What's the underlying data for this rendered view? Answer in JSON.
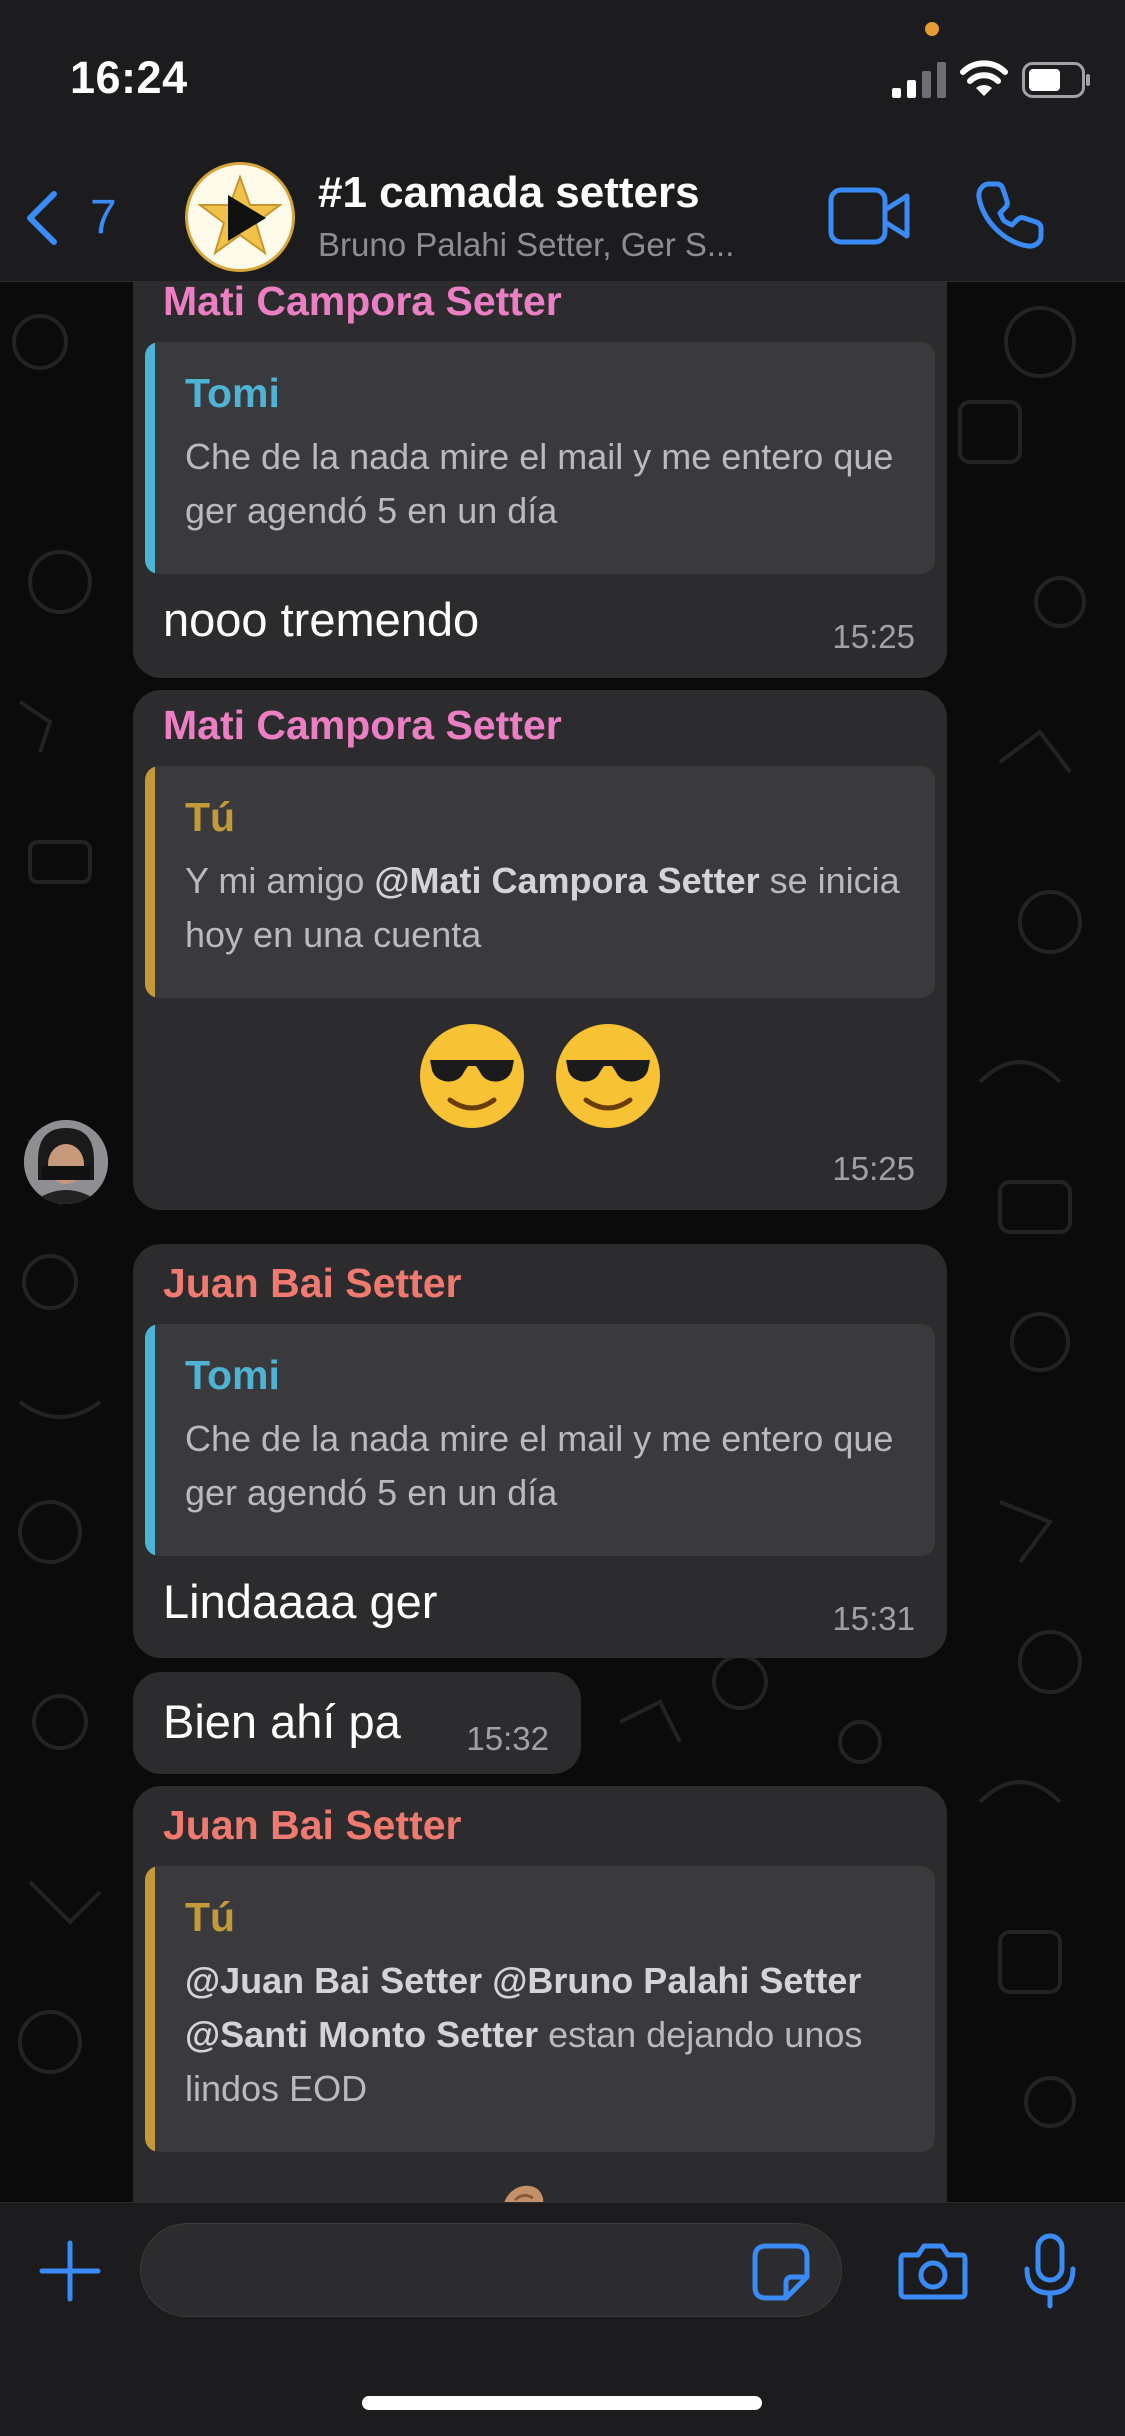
{
  "status_bar": {
    "time": "16:24"
  },
  "header": {
    "back_count": "7",
    "title": "#1 camada setters",
    "subtitle": "Bruno Palahi Setter, Ger S..."
  },
  "messages": [
    {
      "sender": "Mati Campora Setter",
      "quote_author": "Tomi",
      "quote_text": "Che de la nada mire el mail y me entero que ger agendó 5 en un día",
      "text": "nooo tremendo",
      "time": "15:25"
    },
    {
      "sender": "Mati Campora Setter",
      "quote_author": "Tú",
      "quote_text_before": "Y mi amigo ",
      "quote_mention": "@Mati Campora Setter",
      "quote_text_after": " se inicia hoy en una cuenta",
      "emoji": "😎 😎",
      "time": "15:25"
    },
    {
      "sender": "Juan Bai Setter",
      "quote_author": "Tomi",
      "quote_text": "Che de la nada mire el mail y me entero que ger agendó 5 en un día",
      "text": "Lindaaaa ger",
      "time": "15:31"
    },
    {
      "text": "Bien ahí pa",
      "time": "15:32"
    },
    {
      "sender": "Juan Bai Setter",
      "quote_author": "Tú",
      "quote_mention_1": "@Juan Bai Setter",
      "quote_mention_2": "@Bruno Palahi Setter",
      "quote_mention_3": "@Santi Monto Setter",
      "quote_text_after": " estan dejando unos lindos EOD"
    }
  ],
  "input": {
    "placeholder": ""
  },
  "colors": {
    "accent": "#3a8bf5",
    "sender_mati": "#ec7fc3",
    "sender_juan": "#f07a6f",
    "quote_tomi": "#4fb3d6",
    "quote_tu": "#c39a3a",
    "bubble": "#2c2c2e"
  },
  "icons": {
    "back": "chevron-left-icon",
    "video": "video-camera-icon",
    "call": "phone-icon",
    "plus": "plus-icon",
    "sticker": "sticker-icon",
    "camera": "camera-icon",
    "mic": "microphone-icon"
  }
}
